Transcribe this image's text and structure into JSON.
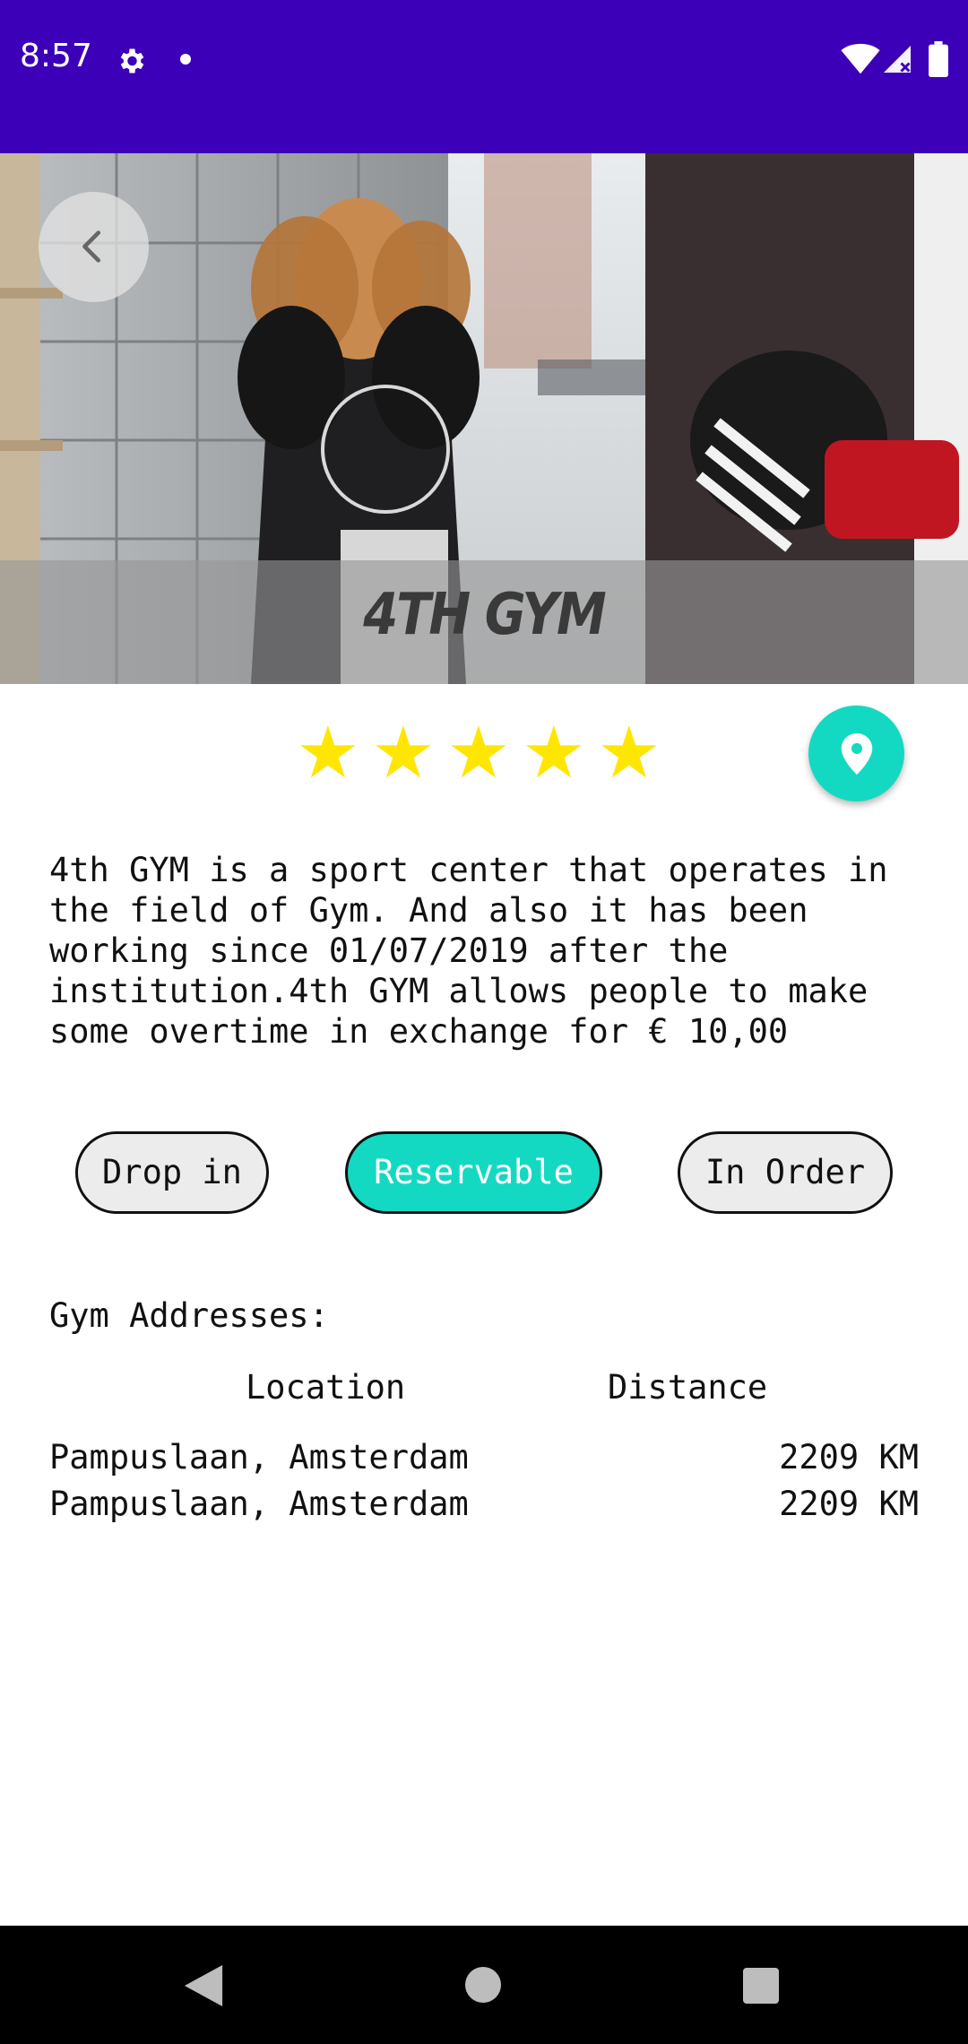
{
  "status_bar": {
    "time": "8:57",
    "icons": [
      "settings-gear-icon",
      "notification-dot-icon",
      "wifi-icon",
      "cell-signal-icon",
      "battery-icon"
    ],
    "background": "#3b00b8"
  },
  "hero": {
    "title": "4TH GYM",
    "image": "boxing-gym-photo",
    "back_icon": "chevron-left-icon"
  },
  "rating": {
    "stars": 5,
    "max": 5,
    "star_glyph": "★",
    "color": "#ffe600"
  },
  "map_button": {
    "icon": "location-pin-icon",
    "color": "#14d9c2"
  },
  "description": "4th GYM is a sport center that operates in the field of Gym. And also it has been working since 01/07/2019 after the institution.4th GYM allows people to make some overtime in exchange for € 10,00",
  "chips": [
    {
      "label": "Drop in",
      "active": false
    },
    {
      "label": "Reservable",
      "active": true
    },
    {
      "label": "In Order",
      "active": false
    }
  ],
  "addresses": {
    "heading": "Gym Addresses:",
    "columns": {
      "location": "Location",
      "distance": "Distance"
    },
    "rows": [
      {
        "location": "Pampuslaan, Amsterdam",
        "distance": "2209 KM"
      },
      {
        "location": "Pampuslaan, Amsterdam",
        "distance": "2209 KM"
      }
    ]
  },
  "nav_bar": {
    "icons": [
      "nav-back-icon",
      "nav-home-icon",
      "nav-recents-icon"
    ]
  }
}
